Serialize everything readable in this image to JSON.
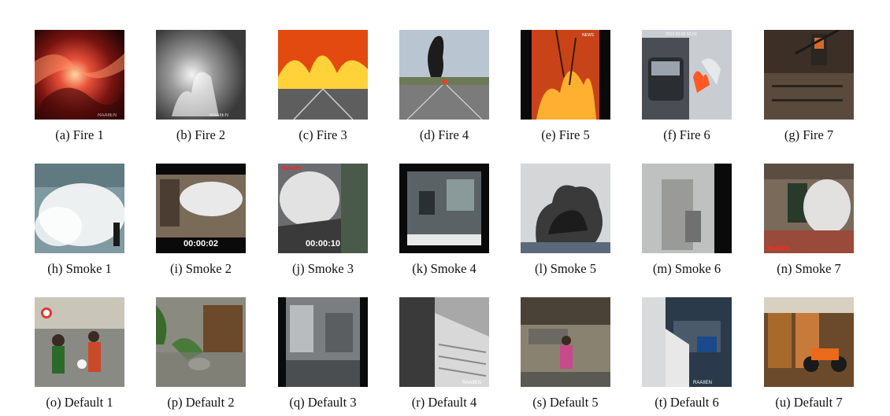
{
  "figure": {
    "rows": [
      {
        "category": "fire",
        "items": [
          {
            "caption": "(a) Fire 1",
            "thumb": "fire-flames",
            "overlay_text": "RAAIIEN"
          },
          {
            "caption": "(b) Fire 2",
            "thumb": "fire-grayscale",
            "overlay_text": "RAAIIEN"
          },
          {
            "caption": "(c) Fire 3",
            "thumb": "fire-highway-explosion",
            "overlay_text": ""
          },
          {
            "caption": "(d) Fire 4",
            "thumb": "fire-highway-smoke-column",
            "overlay_text": ""
          },
          {
            "caption": "(e) Fire 5",
            "thumb": "fire-night-blaze",
            "overlay_text": "NEWS"
          },
          {
            "caption": "(f) Fire 6",
            "thumb": "fire-car-cctv",
            "overlay_text": "2012-01-02 02:03"
          },
          {
            "caption": "(g) Fire 7",
            "thumb": "fire-building-crane",
            "overlay_text": ""
          }
        ]
      },
      {
        "category": "smoke",
        "items": [
          {
            "caption": "(h) Smoke 1",
            "thumb": "smoke-white-room",
            "overlay_text": ""
          },
          {
            "caption": "(i) Smoke 2",
            "thumb": "smoke-shop",
            "overlay_text": "00:00:02"
          },
          {
            "caption": "(j) Smoke 3",
            "thumb": "smoke-hall",
            "overlay_text": "00:00:10"
          },
          {
            "caption": "(k) Smoke 4",
            "thumb": "smoke-office-cctv",
            "overlay_text": ""
          },
          {
            "caption": "(l) Smoke 5",
            "thumb": "smoke-dark-plume",
            "overlay_text": ""
          },
          {
            "caption": "(m) Smoke 6",
            "thumb": "smoke-corridor",
            "overlay_text": ""
          },
          {
            "caption": "(n) Smoke 7",
            "thumb": "smoke-store",
            "overlay_text": "RAAIIEN"
          }
        ]
      },
      {
        "category": "default",
        "items": [
          {
            "caption": "(o) Default 1",
            "thumb": "default-people",
            "overlay_text": ""
          },
          {
            "caption": "(p) Default 2",
            "thumb": "default-courtyard",
            "overlay_text": ""
          },
          {
            "caption": "(q) Default 3",
            "thumb": "default-room",
            "overlay_text": ""
          },
          {
            "caption": "(r) Default 4",
            "thumb": "default-stairs",
            "overlay_text": "RAAIIEN"
          },
          {
            "caption": "(s) Default 5",
            "thumb": "default-kitchen",
            "overlay_text": ""
          },
          {
            "caption": "(t) Default 6",
            "thumb": "default-office",
            "overlay_text": "RAAIIEN"
          },
          {
            "caption": "(u) Default 7",
            "thumb": "default-motorcycle-shop",
            "overlay_text": ""
          }
        ]
      }
    ]
  }
}
